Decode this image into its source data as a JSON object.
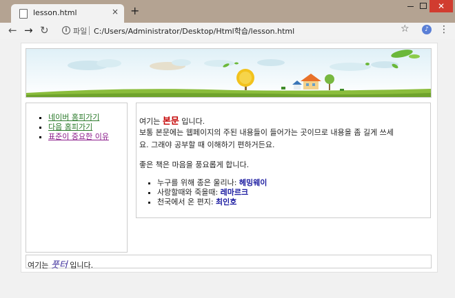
{
  "browser": {
    "tab_title": "lesson.html",
    "tab_close": "×",
    "new_tab": "+",
    "scheme_label": "파일",
    "url": "C:/Users/Administrator/Desktop/Html학습/lesson.html",
    "close_glyph": "✕"
  },
  "sidebar": {
    "links": [
      {
        "label": "네이버 홈피가기"
      },
      {
        "label": "다음 홈피가기"
      },
      {
        "label": "표준이 중요한 이유"
      }
    ]
  },
  "content": {
    "line1_pre": "여기는",
    "line1_emph": "본문",
    "line1_post": "입니다.",
    "line2": "보통 본문에는 웹페이지의 주된 내용들이 들어가는 곳이므로 내용을 좀 길게 쓰세",
    "line3": "요. 그래야 공부할 때 이해하기 편하거든요.",
    "line4": "좋은 책은 마음을 풍요롭게 합니다.",
    "list": [
      {
        "text": "누구를 위해 종은 울리나:",
        "author": "헤밍웨이"
      },
      {
        "text": "사랑할때와 죽을때:",
        "author": "레마르크"
      },
      {
        "text": "천국에서 온 편지:",
        "author": "최인호"
      }
    ]
  },
  "footer": {
    "pre": "여기는",
    "emph": "풋터",
    "post": "입니다."
  },
  "colors": {
    "window_frame": "#b4a392",
    "close_button": "#d13c2f",
    "emphasis_red": "#c40000",
    "author_blue": "#1a1aa0",
    "link_green": "#2a7a2a"
  }
}
